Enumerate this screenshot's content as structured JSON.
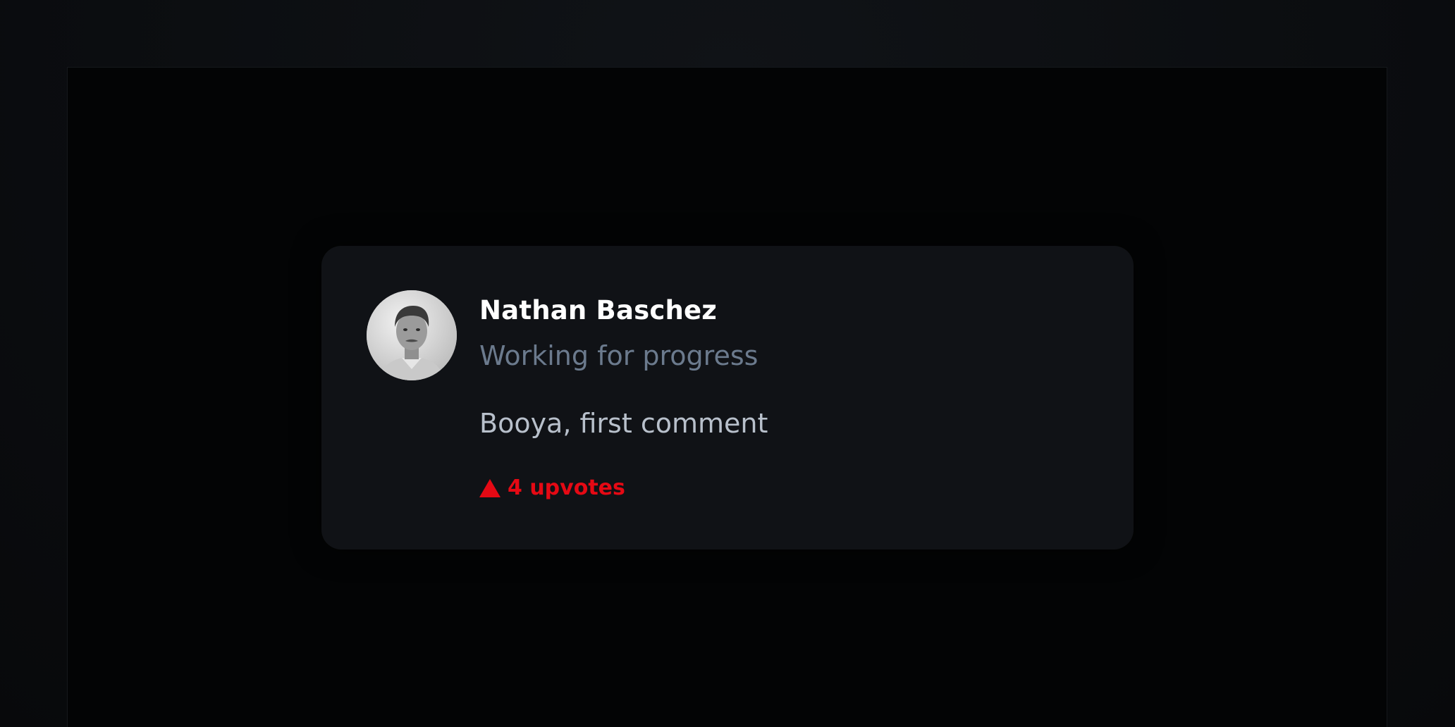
{
  "comment": {
    "author_name": "Nathan Baschez",
    "author_subtitle": "Working for progress",
    "body": "Booya, first comment",
    "upvotes_label": "4 upvotes",
    "upvote_count": 4
  },
  "icons": {
    "upvote": "triangle-up-icon",
    "avatar": "user-photo"
  },
  "colors": {
    "accent": "#e50914",
    "card_bg": "#101216",
    "page_bg": "#030405",
    "subtitle": "#6b7a8d",
    "body_text": "#b8c0cb"
  }
}
